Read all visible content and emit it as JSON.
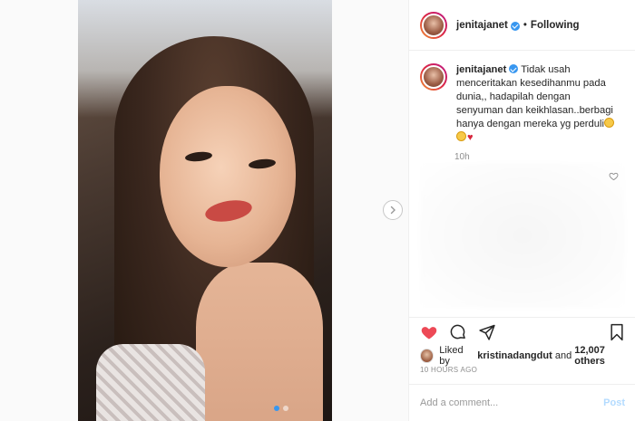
{
  "post": {
    "username": "jenitajanet",
    "follow_status": "Following",
    "separator": "•",
    "caption_user": "jenitajanet",
    "caption_text": "Tidak usah menceritakan kesedihanmu pada dunia,, hadapilah dengan senyuman dan keikhlasan..berbagi hanya dengan mereka yg perduli",
    "caption_time": "10h",
    "liked_by_prefix": "Liked by",
    "liked_by_user": "kristinadangdut",
    "liked_by_and": "and",
    "liked_by_count": "12,007 others",
    "posted_ago": "10 HOURS AGO"
  },
  "comment": {
    "placeholder": "Add a comment...",
    "post_label": "Post"
  },
  "carousel": {
    "slide_count": 2,
    "active_index": 0
  },
  "colors": {
    "accent_blue": "#3897f0",
    "like_red": "#ed4956",
    "story_ring": "#dc2743"
  },
  "icons": [
    "verified-badge-icon",
    "heart-icon",
    "comment-icon",
    "share-icon",
    "bookmark-icon",
    "chevron-right-icon"
  ]
}
